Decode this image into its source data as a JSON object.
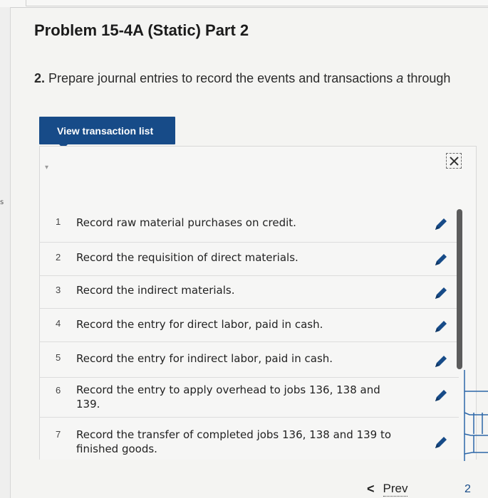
{
  "title": "Problem 15-4A (Static) Part 2",
  "instruction": {
    "number": "2.",
    "text_before": " Prepare journal entries to record the events and transactions ",
    "italic": "a",
    "text_after": " through"
  },
  "view_button": {
    "label": "View transaction list"
  },
  "transactions": [
    {
      "num": "1",
      "text": "Record raw material purchases on credit."
    },
    {
      "num": "2",
      "text": "Record the requisition of direct materials."
    },
    {
      "num": "3",
      "text": "Record the indirect materials."
    },
    {
      "num": "4",
      "text": "Record the entry for direct labor, paid in cash."
    },
    {
      "num": "5",
      "text": "Record the entry for indirect labor, paid in cash."
    },
    {
      "num": "6",
      "text": "Record the entry to apply overhead to jobs 136, 138 and 139."
    },
    {
      "num": "7",
      "text": "Record the transfer of completed jobs 136, 138 and 139 to finished goods."
    }
  ],
  "pagination": {
    "prev_label": "Prev",
    "page": "2"
  },
  "colors": {
    "button": "#174b88",
    "pencil": "#174b88"
  },
  "icons": {
    "edit": "pencil-icon",
    "close": "close-icon",
    "prev": "chevron-left-icon"
  }
}
